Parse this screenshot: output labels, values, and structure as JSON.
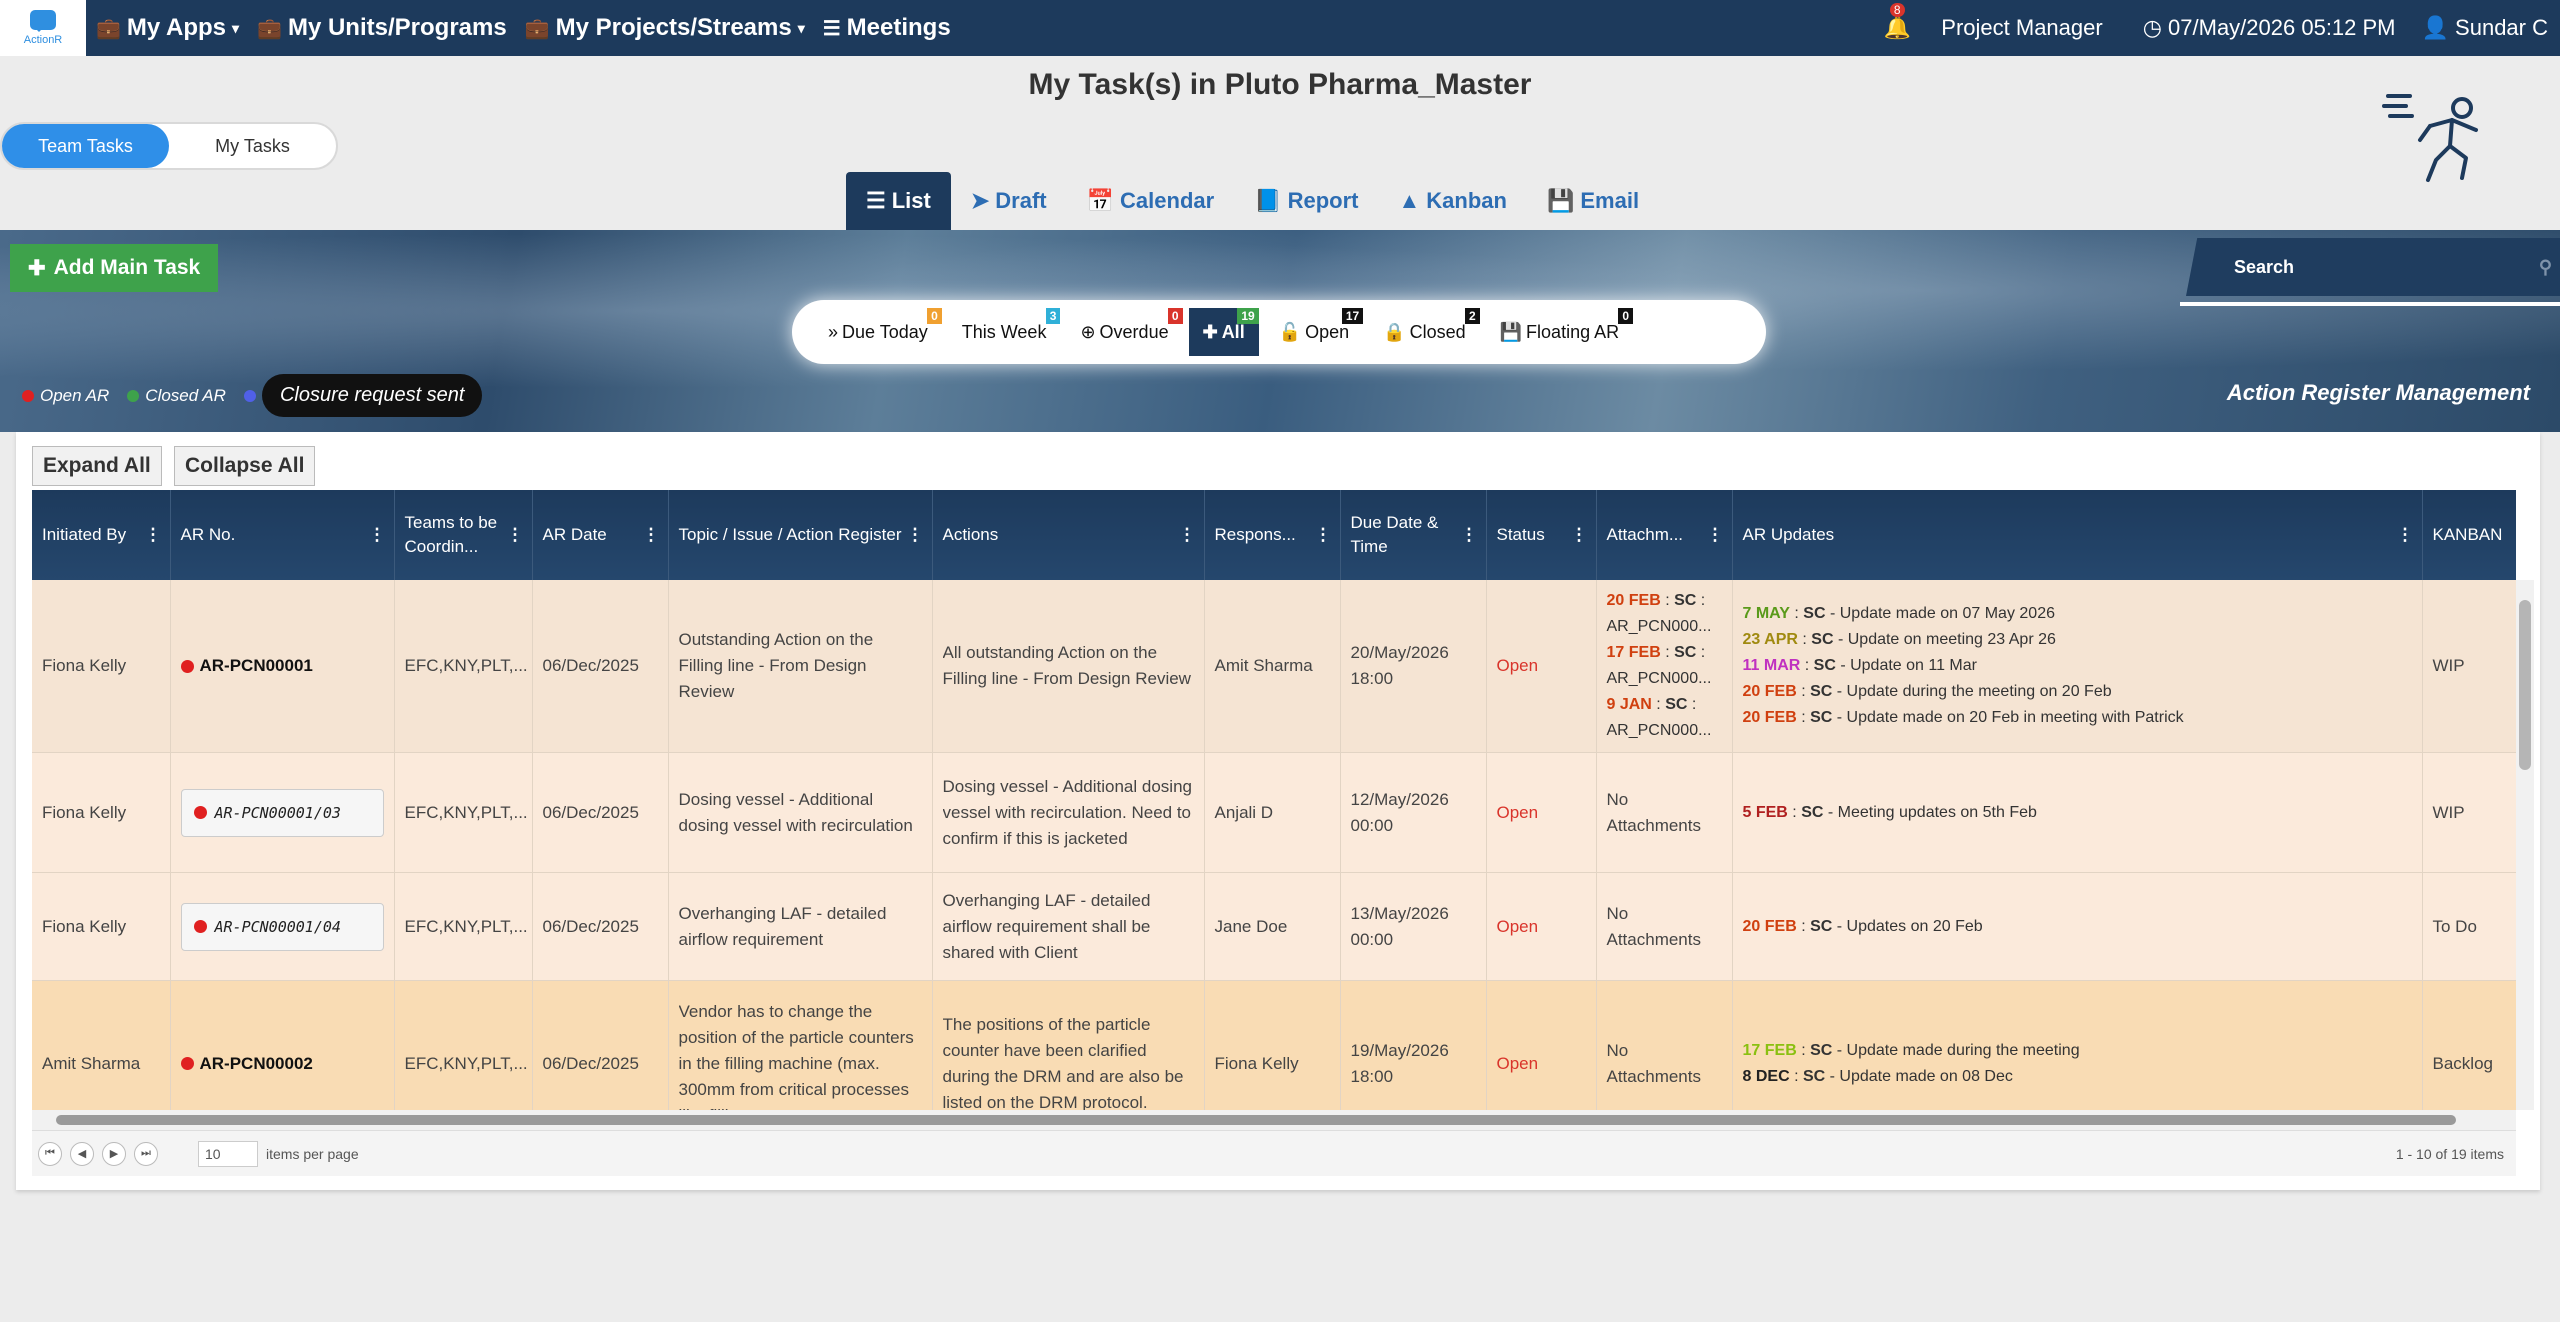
{
  "app": {
    "logo_text": "ActionR"
  },
  "nav": {
    "my_apps": "My Apps",
    "my_units": "My Units/Programs",
    "my_projects": "My Projects/Streams",
    "meetings": "Meetings",
    "notif_count": "8",
    "role": "Project Manager",
    "datetime": "07/May/2026 05:12 PM",
    "user": "Sundar C"
  },
  "page": {
    "title": "My Task(s) in Pluto Pharma_Master"
  },
  "toggle": {
    "team": "Team Tasks",
    "mine": "My Tasks"
  },
  "tabs": [
    "List",
    "Draft",
    "Calendar",
    "Report",
    "Kanban",
    "Email"
  ],
  "actions": {
    "add_main_task": "Add Main Task",
    "search_placeholder": "Search"
  },
  "filters": [
    {
      "label": "Due Today",
      "count": "0",
      "color": "#f0a030"
    },
    {
      "label": "This Week",
      "count": "3",
      "color": "#2fb0d8"
    },
    {
      "label": "Overdue",
      "count": "0",
      "color": "#d9342b"
    },
    {
      "label": "All",
      "count": "19",
      "color": "#3ea24b"
    },
    {
      "label": "Open",
      "count": "17",
      "color": "#111111"
    },
    {
      "label": "Closed",
      "count": "2",
      "color": "#111111"
    },
    {
      "label": "Floating AR",
      "count": "0",
      "color": "#111111"
    }
  ],
  "legend": {
    "open": "Open AR",
    "closed": "Closed AR",
    "closure": "Closure request sent"
  },
  "banner_title": "Action Register Management",
  "grid": {
    "expand": "Expand All",
    "collapse": "Collapse All",
    "columns": [
      "Initiated By",
      "AR No.",
      "Teams to be Coordin...",
      "AR Date",
      "Topic / Issue / Action Register",
      "Actions",
      "Respons...",
      "Due Date & Time",
      "Status",
      "Attachm...",
      "AR Updates",
      "KANBAN"
    ],
    "rows": [
      {
        "initiated": "Fiona Kelly",
        "ar_no": "AR-PCN00001",
        "teams": "EFC,KNY,PLT,...",
        "date": "06/Dec/2025",
        "topic": "Outstanding Action on the Filling line - From Design Review",
        "actions": "All outstanding Action on the Filling line - From Design Review",
        "resp": "Amit Sharma",
        "due": "20/May/2026 18:00",
        "status": "Open",
        "attach": [
          {
            "d": "20 FEB",
            "by": "SC",
            "f": "AR_PCN000..."
          },
          {
            "d": "17 FEB",
            "by": "SC",
            "f": "AR_PCN000..."
          },
          {
            "d": "9 JAN",
            "by": "SC",
            "f": "AR_PCN000..."
          }
        ],
        "updates": [
          {
            "d": "7 MAY",
            "by": "SC",
            "t": "Update made on 07 May 2026",
            "c": "#5a9a1a"
          },
          {
            "d": "23 APR",
            "by": "SC",
            "t": "Update on meeting 23 Apr 26",
            "c": "#a08a10"
          },
          {
            "d": "11 MAR",
            "by": "SC",
            "t": "Update on 11 Mar",
            "c": "#c030c0"
          },
          {
            "d": "20 FEB",
            "by": "SC",
            "t": "Update during the meeting on 20 Feb",
            "c": "#d04010"
          },
          {
            "d": "20 FEB",
            "by": "SC",
            "t": "Update made on 20 Feb in meeting with Patrick",
            "c": "#d04010"
          }
        ],
        "kanban": "WIP"
      },
      {
        "initiated": "Fiona Kelly",
        "ar_no": "AR-PCN00001/03",
        "teams": "EFC,KNY,PLT,...",
        "date": "06/Dec/2025",
        "topic": "Dosing vessel - Additional dosing vessel with recirculation",
        "actions": "Dosing vessel - Additional dosing vessel with recirculation. Need to confirm if this is jacketed",
        "resp": "Anjali D",
        "due": "12/May/2026 00:00",
        "status": "Open",
        "attach_none": "No Attachments",
        "updates": [
          {
            "d": "5 FEB",
            "by": "SC",
            "t": "Meeting updates on 5th Feb",
            "c": "#b02020"
          }
        ],
        "kanban": "WIP"
      },
      {
        "initiated": "Fiona Kelly",
        "ar_no": "AR-PCN00001/04",
        "teams": "EFC,KNY,PLT,...",
        "date": "06/Dec/2025",
        "topic": "Overhanging LAF - detailed airflow requirement",
        "actions": "Overhanging LAF - detailed airflow requirement shall be shared with Client",
        "resp": "Jane Doe",
        "due": "13/May/2026 00:00",
        "status": "Open",
        "attach_none": "No Attachments",
        "updates": [
          {
            "d": "20 FEB",
            "by": "SC",
            "t": "Updates on 20 Feb",
            "c": "#d04010"
          }
        ],
        "kanban": "To Do"
      },
      {
        "initiated": "Amit Sharma",
        "ar_no": "AR-PCN00002",
        "teams": "EFC,KNY,PLT,...",
        "date": "06/Dec/2025",
        "topic": "Vendor has to change the position of the particle counters in the filling machine (max. 300mm from critical processes like filling",
        "actions": "The positions of the particle counter have been clarified during the DRM and are also be listed on the DRM protocol.",
        "resp": "Fiona Kelly",
        "due": "19/May/2026 18:00",
        "status": "Open",
        "attach_none": "No Attachments",
        "updates": [
          {
            "d": "17 FEB",
            "by": "SC",
            "t": "Update made during the meeting",
            "c": "#8ac010"
          },
          {
            "d": "8 DEC",
            "by": "SC",
            "t": "Update made on 08 Dec",
            "c": "#222222"
          }
        ],
        "kanban": "Backlog"
      }
    ]
  },
  "pager": {
    "per_page_value": "10",
    "per_page_label": "items per page",
    "info": "1 - 10 of 19 items"
  }
}
